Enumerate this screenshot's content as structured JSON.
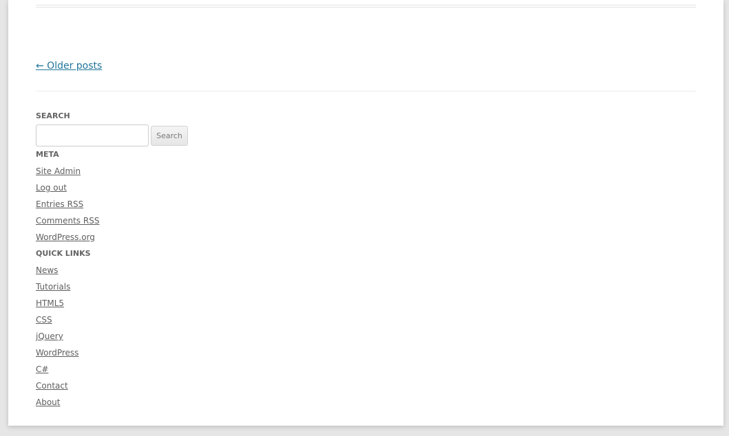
{
  "nav": {
    "older_posts": "← Older posts"
  },
  "search_widget": {
    "title": "SEARCH",
    "input_value": "",
    "button_label": "Search"
  },
  "meta_widget": {
    "title": "META",
    "links": [
      "Site Admin",
      "Log out",
      "Entries RSS",
      "Comments RSS",
      "WordPress.org"
    ]
  },
  "quick_links_widget": {
    "title": "QUICK LINKS",
    "links": [
      "News",
      "Tutorials",
      "HTML5",
      "CSS",
      "jQuery",
      "WordPress",
      "C#",
      "Contact",
      "About"
    ]
  },
  "colors": {
    "link_primary": "#21759b",
    "link_secondary": "#5e5e5e",
    "widget_title": "#636363",
    "page_background": "#e6e6e6",
    "content_background": "#ffffff"
  }
}
